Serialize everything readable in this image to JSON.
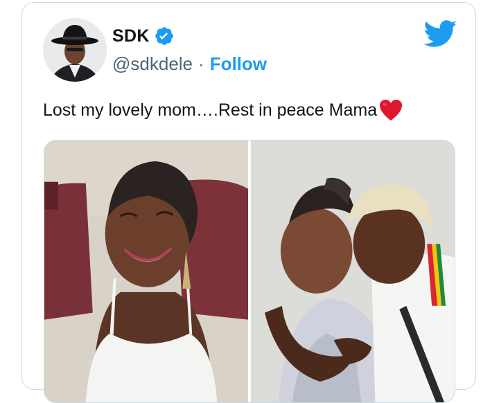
{
  "tweet": {
    "display_name": "SDK",
    "handle": "@sdkdele",
    "separator": "·",
    "follow_label": "Follow",
    "text": "Lost my lovely mom….Rest in peace Mama",
    "verified": true,
    "icons": {
      "verified": "verified-badge-icon",
      "brand": "twitter-bird-icon",
      "emoji": "red-heart-icon"
    },
    "colors": {
      "accent": "#1d9bf0",
      "text": "#0f1419",
      "secondary": "#536471",
      "heart": "#e0182d"
    }
  },
  "media": {
    "photos": [
      {
        "subject": "smiling older woman in white top"
      },
      {
        "subject": "man in white cap hugging older woman"
      }
    ]
  }
}
